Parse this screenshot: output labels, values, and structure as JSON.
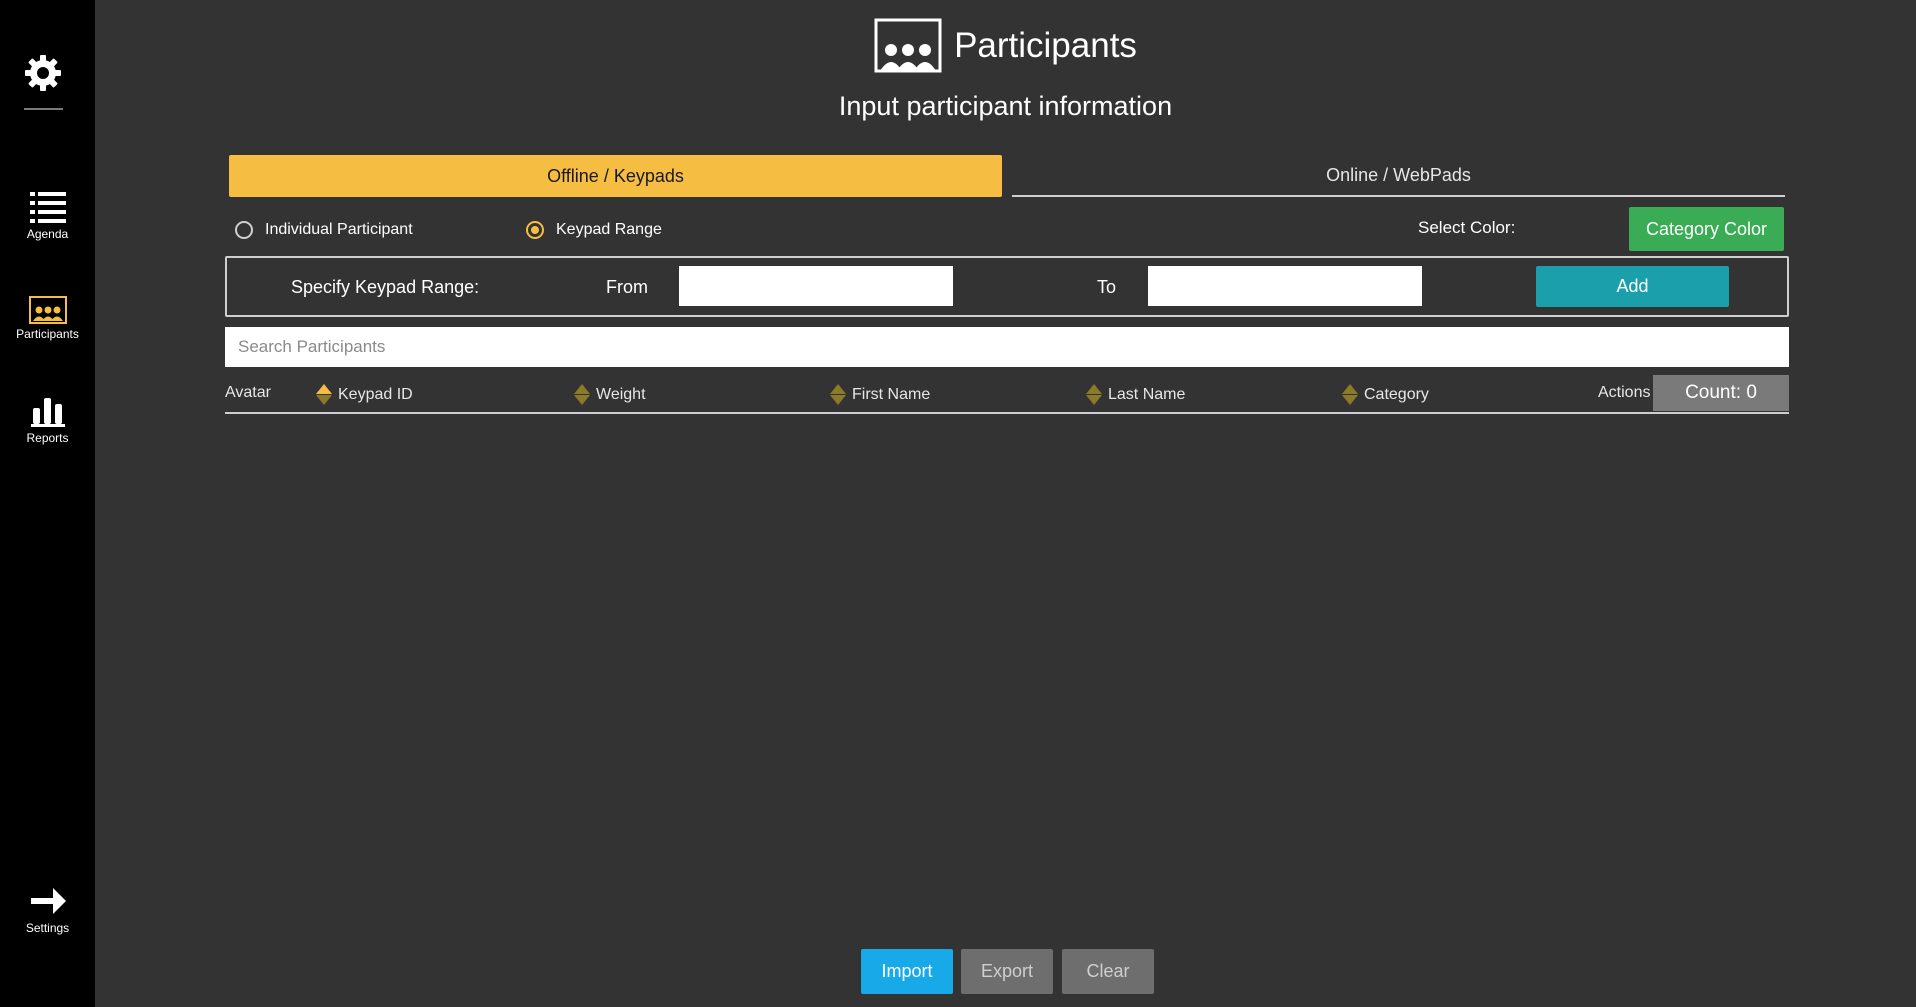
{
  "sidebar": {
    "items": [
      {
        "label": "Agenda",
        "icon": "list-icon"
      },
      {
        "label": "Participants",
        "icon": "participants-icon"
      },
      {
        "label": "Reports",
        "icon": "bar-chart-icon"
      },
      {
        "label": "Settings",
        "icon": "arrow-right-icon"
      }
    ],
    "accent": "#f6bd43"
  },
  "header": {
    "title": "Participants",
    "subtitle": "Input participant information"
  },
  "tabs": [
    {
      "label": "Offline / Keypads",
      "active": true
    },
    {
      "label": "Online / WebPads",
      "active": false
    }
  ],
  "mode": {
    "options": [
      {
        "label": "Individual Participant",
        "selected": false
      },
      {
        "label": "Keypad Range",
        "selected": true
      }
    ],
    "select_color_label": "Select Color:",
    "category_color_button": "Category Color"
  },
  "range": {
    "label": "Specify Keypad Range:",
    "from_label": "From",
    "to_label": "To",
    "from_value": "",
    "to_value": "",
    "add_button": "Add"
  },
  "search": {
    "placeholder": "Search Participants",
    "value": ""
  },
  "table": {
    "columns": [
      "Avatar",
      "Keypad ID",
      "Weight",
      "First Name",
      "Last Name",
      "Category",
      "Actions"
    ],
    "count_label": "Count: 0",
    "rows": []
  },
  "footer": {
    "import": "Import",
    "export": "Export",
    "clear": "Clear"
  },
  "colors": {
    "tab_active": "#f6bd43",
    "category_button": "#3aac55",
    "add_button": "#1a9fab",
    "import_button": "#18a9e8",
    "disabled_button": "#6e6e6e"
  }
}
